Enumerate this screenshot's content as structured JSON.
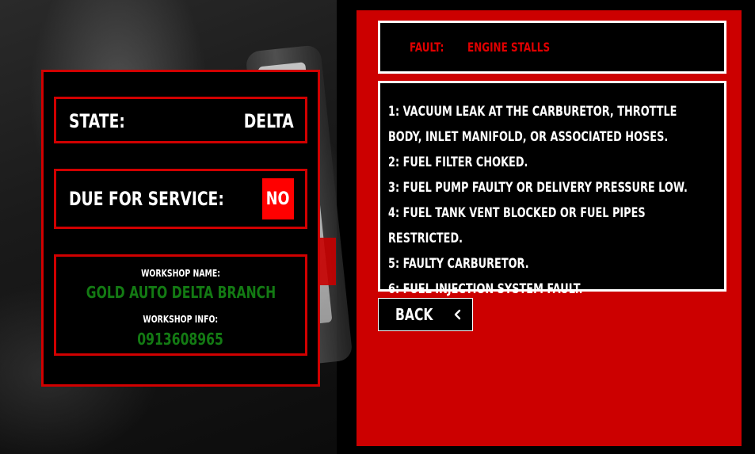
{
  "vehicle": {
    "state_label": "STATE:",
    "state_value": "DELTA",
    "service_label": "DUE FOR SERVICE:",
    "service_value": "NO",
    "service_badge_color": "#ff0000"
  },
  "workshop": {
    "name_label": "WORKSHOP NAME:",
    "name_value": "GOLD AUTO DELTA BRANCH",
    "info_label": "WORKSHOP INFO:",
    "info_value": "0913608965",
    "value_color": "#137a13"
  },
  "fault": {
    "label": "FAULT:",
    "value": "ENGINE STALLS",
    "text_color": "#e00000"
  },
  "causes": [
    "1: Vacuum leak at the carburetor, throttle body, inlet manifold, or associated hoses.",
    "2: Fuel filter choked.",
    "3: Fuel pump faulty or delivery pressure low.",
    "4: Fuel tank vent blocked or fuel pipes restricted.",
    "5: Faulty carburetor.",
    "6: Fuel injection system fault."
  ],
  "navigation": {
    "back_label": "BACK",
    "back_icon": "chevron-left-icon"
  },
  "theme": {
    "accent_red": "#cc0000",
    "panel_border_red": "#d10000",
    "panel_background": "#000000"
  }
}
